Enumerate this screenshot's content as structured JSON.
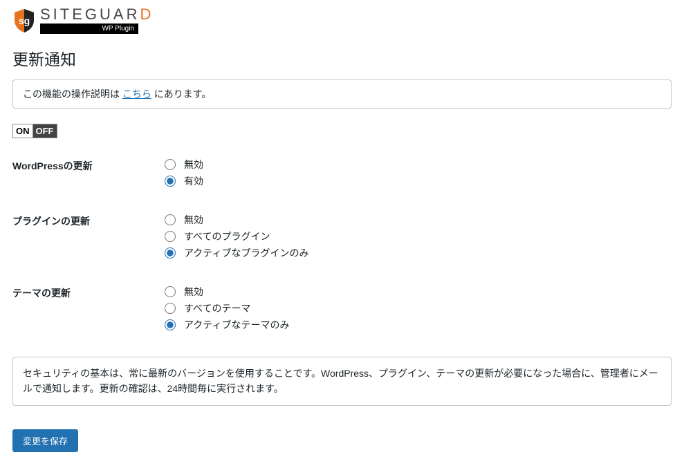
{
  "brand": {
    "name_pre": "SITEGUAR",
    "name_accent": "D",
    "sub": "WP Plugin"
  },
  "page_title": "更新通知",
  "notice": {
    "prefix": "この機能の操作説明は ",
    "link": "こちら",
    "suffix": " にあります。"
  },
  "toggle": {
    "on": "ON",
    "off": "OFF",
    "state": "on"
  },
  "sections": {
    "wp": {
      "label": "WordPressの更新",
      "opts": [
        {
          "value": "disable",
          "label": "無効",
          "checked": false
        },
        {
          "value": "enable",
          "label": "有効",
          "checked": true
        }
      ]
    },
    "plugins": {
      "label": "プラグインの更新",
      "opts": [
        {
          "value": "disable",
          "label": "無効",
          "checked": false
        },
        {
          "value": "all",
          "label": "すべてのプラグイン",
          "checked": false
        },
        {
          "value": "active",
          "label": "アクティブなプラグインのみ",
          "checked": true
        }
      ]
    },
    "themes": {
      "label": "テーマの更新",
      "opts": [
        {
          "value": "disable",
          "label": "無効",
          "checked": false
        },
        {
          "value": "all",
          "label": "すべてのテーマ",
          "checked": false
        },
        {
          "value": "active",
          "label": "アクティブなテーマのみ",
          "checked": true
        }
      ]
    }
  },
  "description": "セキュリティの基本は、常に最新のバージョンを使用することです。WordPress、プラグイン、テーマの更新が必要になった場合に、管理者にメールで通知します。更新の確認は、24時間毎に実行されます。",
  "submit_label": "変更を保存"
}
